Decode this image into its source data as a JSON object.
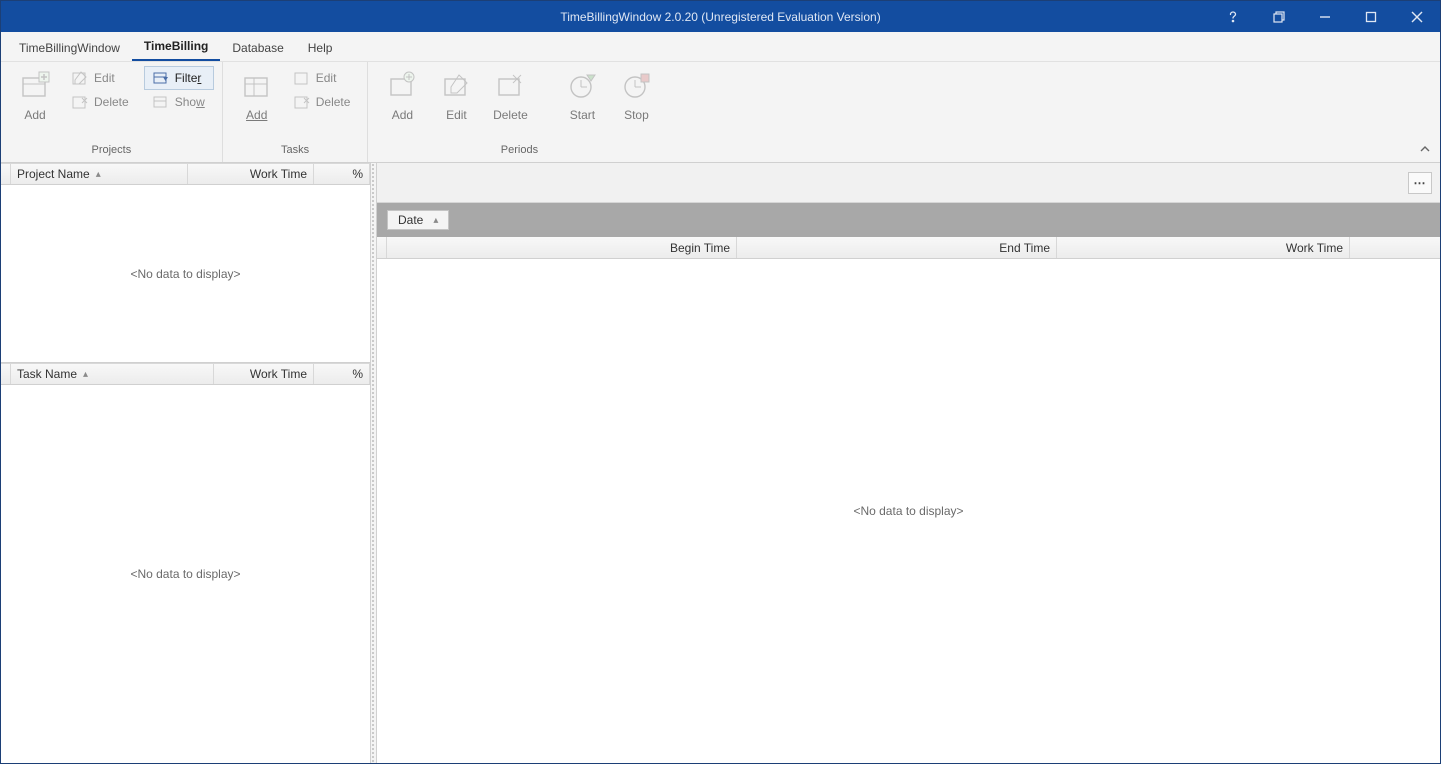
{
  "title": "TimeBillingWindow 2.0.20 (Unregistered Evaluation Version)",
  "menu": {
    "items": [
      "TimeBillingWindow",
      "TimeBilling",
      "Database",
      "Help"
    ],
    "active_index": 1
  },
  "ribbon": {
    "groups": {
      "projects": {
        "title": "Projects",
        "add": "Add",
        "edit": "Edit",
        "delete": "Delete",
        "filter": "Filter",
        "show": "Show"
      },
      "tasks": {
        "title": "Tasks",
        "add": "Add",
        "edit": "Edit",
        "delete": "Delete"
      },
      "periods": {
        "title": "Periods",
        "add": "Add",
        "edit": "Edit",
        "delete": "Delete",
        "start": "Start",
        "stop": "Stop"
      }
    }
  },
  "grids": {
    "projects": {
      "col_name": "Project Name",
      "col_worktime": "Work Time",
      "col_percent": "%",
      "empty": "<No data to display>"
    },
    "tasks": {
      "col_name": "Task Name",
      "col_worktime": "Work Time",
      "col_percent": "%",
      "empty": "<No data to display>"
    },
    "periods": {
      "group_by": "Date",
      "col_begin": "Begin Time",
      "col_end": "End Time",
      "col_worktime": "Work Time",
      "empty": "<No data to display>"
    }
  },
  "misc": {
    "ellipsis": "…"
  }
}
